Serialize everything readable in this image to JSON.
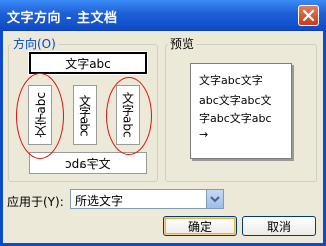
{
  "window": {
    "title": "文字方向 - 主文档"
  },
  "orientation": {
    "label": "方向(O)",
    "options": [
      {
        "id": "horizontal",
        "text": "文字abc",
        "selected": true
      },
      {
        "id": "vertical-rotated-left",
        "text": "文字abc"
      },
      {
        "id": "vertical-stacked",
        "text": "文字abc"
      },
      {
        "id": "vertical-rotated-right",
        "text": "文字abc"
      },
      {
        "id": "horizontal-mirrored",
        "text": "文字abc"
      }
    ]
  },
  "preview": {
    "label": "预览",
    "lines": [
      "文字abc文字",
      "abc文字abc文",
      "字abc文字abc",
      "→"
    ]
  },
  "apply_to": {
    "label": "应用于(Y):",
    "value": "所选文字"
  },
  "buttons": {
    "ok": "确定",
    "cancel": "取消"
  },
  "colors": {
    "titlebar": "#1f5fd6",
    "dialog_bg": "#ece9d8",
    "highlight_ring": "#e01010"
  }
}
